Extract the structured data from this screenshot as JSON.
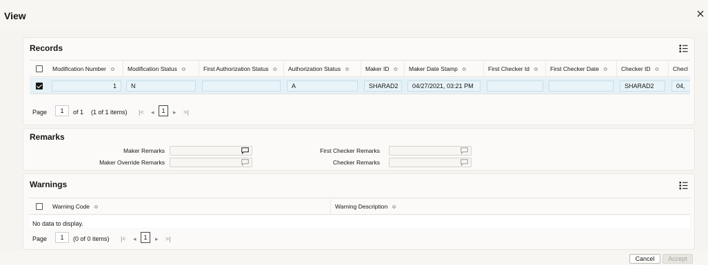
{
  "dialog": {
    "title": "View",
    "close_icon": "close-icon"
  },
  "records": {
    "title": "Records",
    "columns": [
      "Modification Number",
      "Modification Status",
      "First Authorization Status",
      "Authorization Status",
      "Maker ID",
      "Maker Date Stamp",
      "First Checker Id",
      "First Checker Date",
      "Checker ID",
      "Checl"
    ],
    "row": [
      "1",
      "N",
      "",
      "A",
      "SHARAD2",
      "04/27/2021, 03:21 PM",
      "",
      "",
      "SHARAD2",
      "04,"
    ],
    "pager": {
      "page_label": "Page",
      "page_value": "1",
      "of_total": "of 1",
      "items": "(1 of 1 items)",
      "current": "1",
      "first": "|<",
      "prev": "◂",
      "next": "▸",
      "last": ">|"
    }
  },
  "remarks": {
    "title": "Remarks",
    "maker_remarks": "Maker Remarks",
    "maker_override_remarks": "Maker Override Remarks",
    "first_checker_remarks": "First Checker Remarks",
    "checker_remarks": "Checker Remarks"
  },
  "warnings": {
    "title": "Warnings",
    "columns": [
      "Warning Code",
      "Warning Description"
    ],
    "empty_text": "No data to display.",
    "pager": {
      "page_label": "Page",
      "page_value": "1",
      "items": "(0 of 0 items)",
      "current": "1",
      "first": "|<",
      "prev": "◂",
      "next": "▸",
      "last": ">|"
    }
  },
  "footer": {
    "cancel": "Cancel",
    "accept": "Accept"
  },
  "sort_glyph": "≎"
}
